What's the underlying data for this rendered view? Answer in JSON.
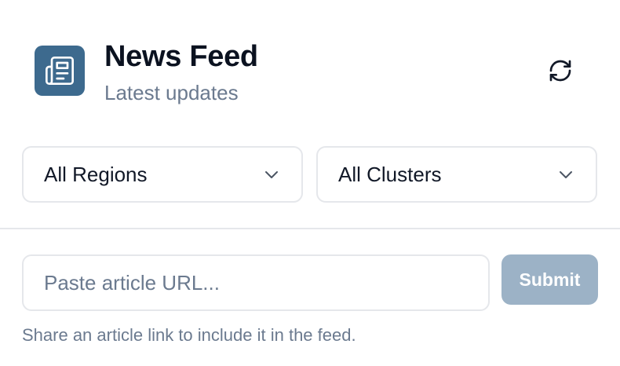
{
  "header": {
    "title": "News Feed",
    "subtitle": "Latest updates",
    "logo_icon": "newspaper-icon",
    "refresh_icon": "refresh-icon"
  },
  "filters": {
    "region": {
      "selected": "All Regions",
      "icon": "chevron-down-icon"
    },
    "cluster": {
      "selected": "All Clusters",
      "icon": "chevron-down-icon"
    }
  },
  "submit_form": {
    "url_placeholder": "Paste article URL...",
    "url_value": "",
    "submit_label": "Submit",
    "hint": "Share an article link to include it in the feed."
  },
  "colors": {
    "brand": "#3d6a8e",
    "submit_disabled": "#9cb2c6",
    "muted_text": "#6b7a8f",
    "border": "#e5e7eb"
  }
}
